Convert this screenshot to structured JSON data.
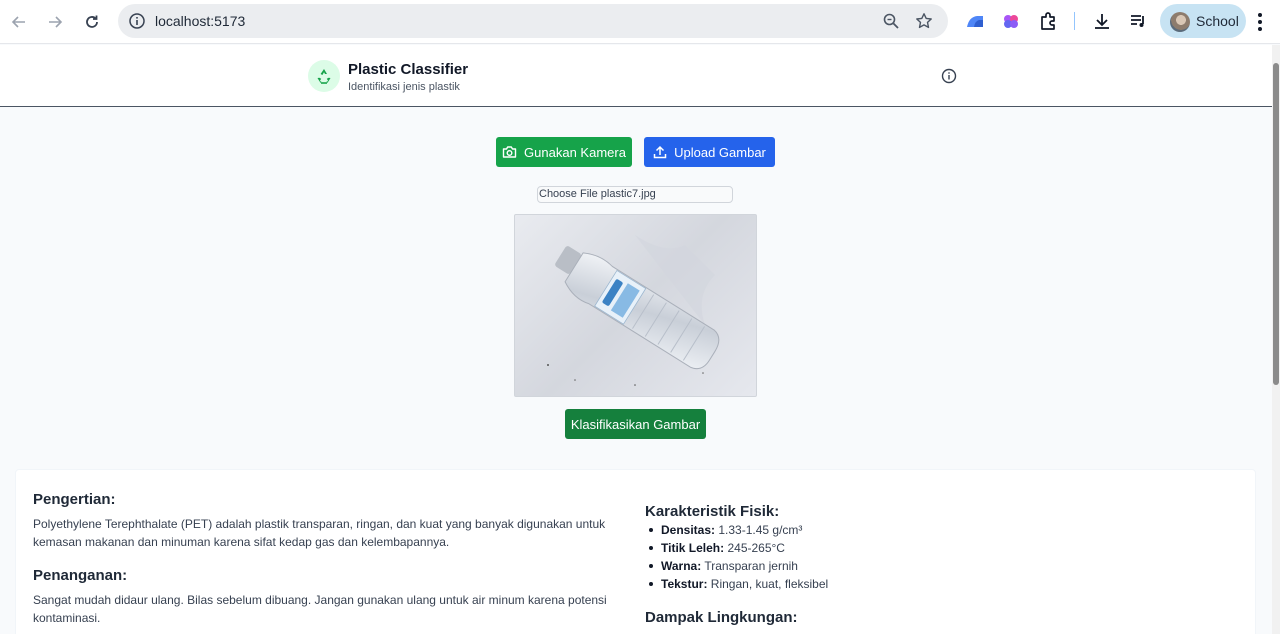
{
  "browser": {
    "url": "localhost:5173",
    "profile_name": "School"
  },
  "header": {
    "title": "Plastic Classifier",
    "subtitle": "Identifikasi jenis plastik"
  },
  "actions": {
    "camera_label": "Gunakan Kamera",
    "upload_label": "Upload Gambar",
    "classify_label": "Klasifikasikan Gambar"
  },
  "file_input": {
    "button_label": "Choose File",
    "filename": "plastic7.jpg"
  },
  "info": {
    "definition_heading": "Pengertian:",
    "definition_text": "Polyethylene Terephthalate (PET) adalah plastik transparan, ringan, dan kuat yang banyak digunakan untuk kemasan makanan dan minuman karena sifat kedap gas dan kelembapannya.",
    "handling_heading": "Penanganan:",
    "handling_text": "Sangat mudah didaur ulang. Bilas sebelum dibuang. Jangan gunakan ulang untuk air minum karena potensi kontaminasi.",
    "physical_heading": "Karakteristik Fisik:",
    "physical_items": [
      {
        "label": "Densitas:",
        "value": "1.33-1.45 g/cm³"
      },
      {
        "label": "Titik Leleh:",
        "value": "245-265°C"
      },
      {
        "label": "Warna:",
        "value": "Transparan jernih"
      },
      {
        "label": "Tekstur:",
        "value": "Ringan, kuat, fleksibel"
      }
    ],
    "impact_heading": "Dampak Lingkungan:"
  },
  "colors": {
    "camera_button": "#16a34a",
    "upload_button": "#2563eb",
    "classify_button": "#15803d"
  }
}
